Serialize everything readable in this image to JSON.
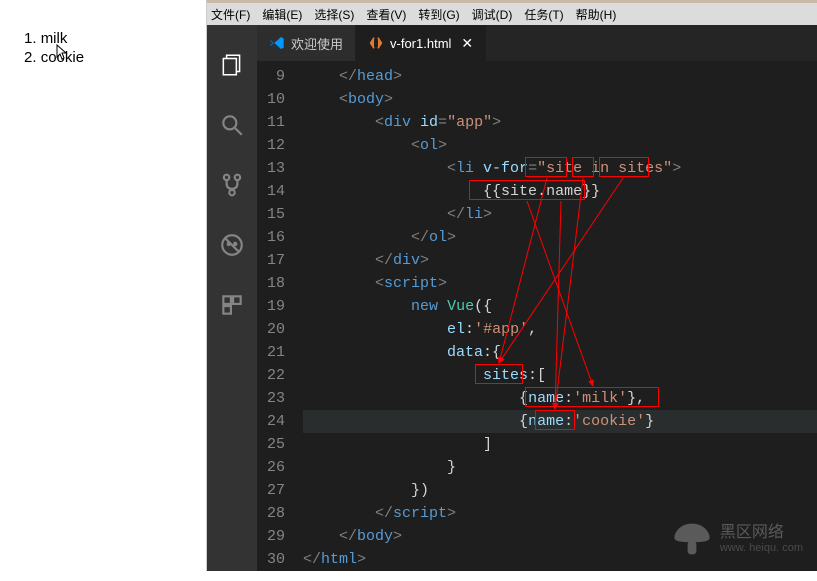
{
  "browser": {
    "items": [
      "milk",
      "cookie"
    ]
  },
  "menu": {
    "file": "文件(F)",
    "edit": "编辑(E)",
    "select": "选择(S)",
    "view": "查看(V)",
    "goto": "转到(G)",
    "debug": "调试(D)",
    "task": "任务(T)",
    "help": "帮助(H)"
  },
  "tabs": {
    "welcome": "欢迎使用",
    "file": "v-for1.html",
    "close": "✕"
  },
  "line_numbers": [
    "9",
    "10",
    "11",
    "12",
    "13",
    "14",
    "15",
    "16",
    "17",
    "18",
    "19",
    "20",
    "21",
    "22",
    "23",
    "24",
    "25",
    "26",
    "27",
    "28",
    "29",
    "30"
  ],
  "code": {
    "l9": {
      "p1": "    </",
      "t": "head",
      "p2": ">"
    },
    "l10": {
      "p1": "    <",
      "t": "body",
      "p2": ">"
    },
    "l11": {
      "p1": "        <",
      "t": "div",
      "a": " id",
      "eq": "=",
      "v": "\"app\"",
      "p2": ">"
    },
    "l12": {
      "p1": "            <",
      "t": "ol",
      "p2": ">"
    },
    "l13": {
      "p1": "                <",
      "t": "li",
      "a": " v-for",
      "eq": "=",
      "q1": "\"",
      "v1": "site",
      "sp1": " ",
      "in": "in",
      "sp2": " ",
      "v2": "sites",
      "q2": "\"",
      "p2": ">"
    },
    "l14": {
      "pad": "                    ",
      "d1": "{{",
      "v1": "site",
      "dot": ".",
      "v2": "name",
      "d2": "}}"
    },
    "l15": {
      "p1": "                </",
      "t": "li",
      "p2": ">"
    },
    "l16": {
      "p1": "            </",
      "t": "ol",
      "p2": ">"
    },
    "l17": {
      "p1": "        </",
      "t": "div",
      "p2": ">"
    },
    "l18": {
      "p1": "        <",
      "t": "script",
      "p2": ">"
    },
    "l19": {
      "pad": "            ",
      "kw": "new",
      "sp": " ",
      "cls": "Vue",
      "p": "({"
    },
    "l20": {
      "pad": "                ",
      "k": "el",
      "c": ":",
      "v": "'#app'",
      "cm": ","
    },
    "l21": {
      "pad": "                ",
      "k": "data",
      "c": ":{"
    },
    "l22": {
      "pad": "                    ",
      "k": "sites",
      "c": ":["
    },
    "l23": {
      "pad": "                        ",
      "b1": "{",
      "k": "name",
      "c": ":",
      "v": "'milk'",
      "b2": "},"
    },
    "l24": {
      "pad": "                        ",
      "b1": "{",
      "k": "name",
      "c": ":",
      "v": "'cookie'",
      "b2": "}"
    },
    "l25": {
      "pad": "                    ",
      "b": "]"
    },
    "l26": {
      "pad": "                ",
      "b": "}"
    },
    "l27": {
      "pad": "            ",
      "b": "})"
    },
    "l28": {
      "p1": "        </",
      "t": "script",
      "p2": ">"
    },
    "l29": {
      "p1": "    </",
      "t": "body",
      "p2": ">"
    },
    "l30": {
      "p1": "</",
      "t": "html",
      "p2": ">"
    }
  },
  "watermark": {
    "text": "黑区网络",
    "url": "www. heiqu. com"
  }
}
